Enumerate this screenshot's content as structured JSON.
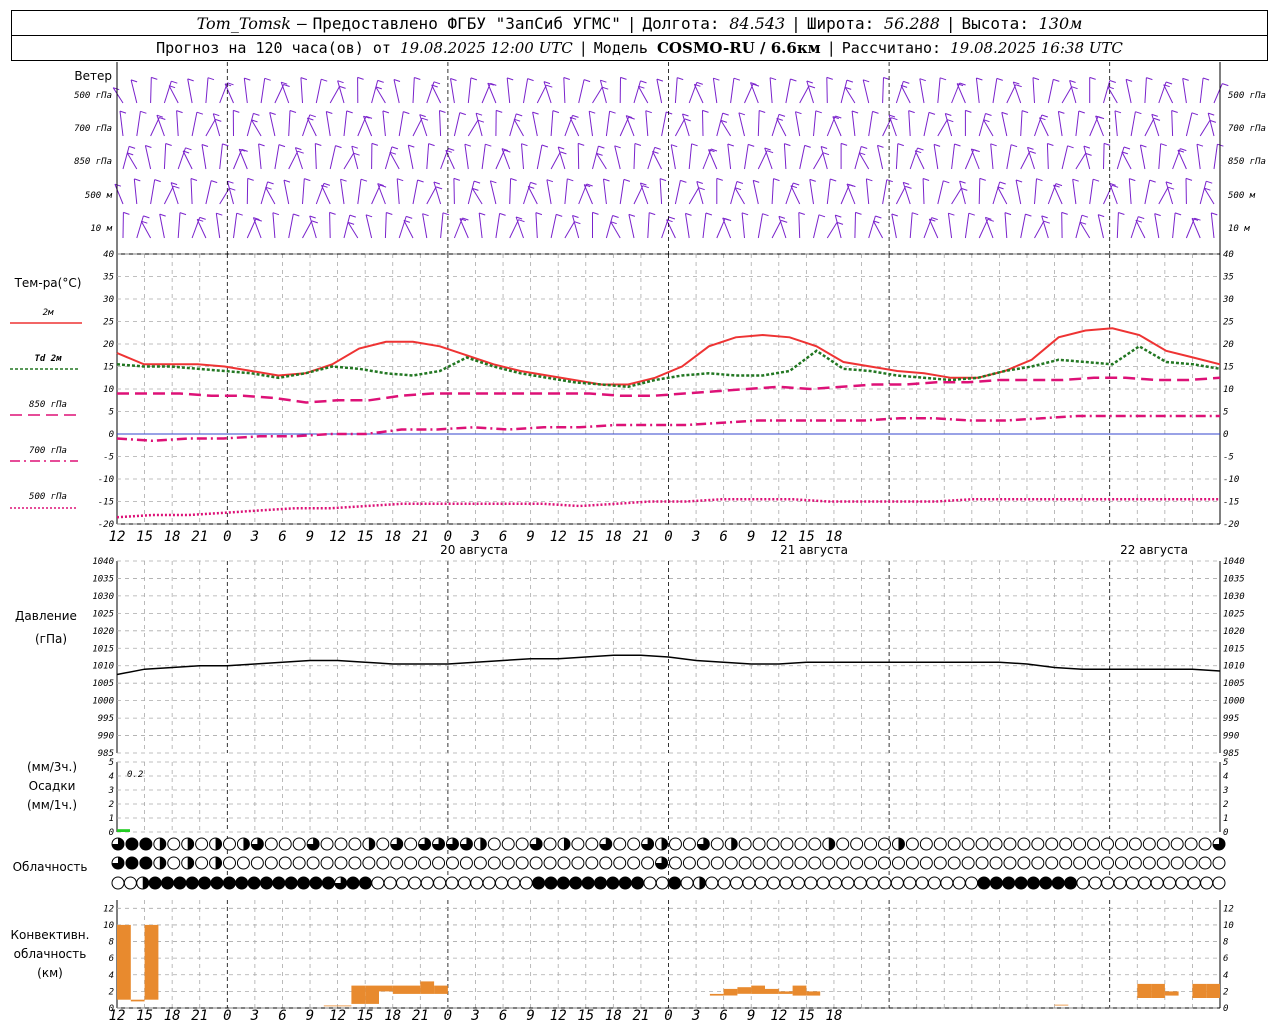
{
  "header": {
    "station": "Tom_Tomsk",
    "dash": "–",
    "provider": "Предоставлено ФГБУ \"ЗапСиб УГМС\"",
    "lon_label": "Долгота:",
    "lon": "84.543",
    "lat_label": "Широта:",
    "lat": "56.288",
    "alt_label": "Высота:",
    "alt": "130м",
    "forecast_prefix": "Прогноз на 120 часа(ов) от",
    "forecast_date": "19.08.2025 12:00 UTC",
    "model_label": "Модель",
    "model": "COSMO-RU / 6.6км",
    "computed_label": "Рассчитано:",
    "computed": "19.08.2025 16:38 UTC"
  },
  "wind_panel": {
    "title": "Ветер",
    "levels": [
      "500 гПа",
      "700 гПа",
      "850 гПа",
      "500 м",
      "10  м"
    ],
    "right_levels": [
      "500 гПа",
      "700 гПа",
      "850 гПа",
      "500 м",
      "10  м"
    ]
  },
  "temp_panel": {
    "title": "Тем-ра(°C)",
    "legend": [
      {
        "label": "2м",
        "color": "#ee3333",
        "dash": ""
      },
      {
        "label": "Td  2м",
        "color": "#227722",
        "dash": "3,2"
      },
      {
        "label": "850 гПа",
        "color": "#dd1177",
        "dash": "12,6"
      },
      {
        "label": "700 гПа",
        "color": "#dd1177",
        "dash": "10,4,2,4"
      },
      {
        "label": "500 гПа",
        "color": "#dd1177",
        "dash": "2,2"
      }
    ]
  },
  "pressure_panel": {
    "title": "Давление",
    "unit": "(гПа)"
  },
  "precip_panel": {
    "unit_top": "(мм/3ч.)",
    "title": "Осадки",
    "unit_bottom": "(мм/1ч.)",
    "annotation": "0.2"
  },
  "cloud_panel": {
    "title": "Облачность"
  },
  "conv_panel": {
    "title_1": "Конвективн.",
    "title_2": "облачность",
    "unit": "(км)"
  },
  "x_hour_labels": [
    "12",
    "15",
    "18",
    "21",
    "0",
    "3",
    "6",
    "9",
    "12",
    "15",
    "18",
    "21",
    "0",
    "3",
    "6",
    "9",
    "12",
    "15",
    "18",
    "21",
    "0",
    "3",
    "6",
    "9",
    "12",
    "15",
    "18"
  ],
  "date_labels": [
    "20 августа",
    "21 августа",
    "22 августа"
  ],
  "chart_data": [
    {
      "type": "line",
      "name": "temperature",
      "ylim": [
        -20,
        40
      ],
      "yticks": [
        -20,
        -15,
        -10,
        -5,
        0,
        5,
        10,
        15,
        20,
        25,
        30,
        35,
        40
      ],
      "x_hours": [
        0,
        3,
        6,
        9,
        12,
        15,
        18,
        21,
        24,
        27,
        30,
        33,
        36,
        39,
        42,
        45,
        48,
        51,
        54,
        57,
        60,
        63,
        66,
        69,
        72,
        75,
        78,
        81,
        84,
        87,
        90,
        93,
        96,
        99,
        102,
        105,
        108,
        111,
        114,
        117,
        120
      ],
      "series": [
        {
          "name": "2м",
          "values": [
            18,
            15.5,
            15.5,
            15.5,
            15,
            14,
            13,
            13.5,
            15.5,
            19,
            20.5,
            20.5,
            19.5,
            17.5,
            15.5,
            14,
            13,
            12,
            11,
            11,
            12.5,
            15,
            19.5,
            21.5,
            22,
            21.5,
            19.5,
            16,
            15,
            14,
            13.5,
            12.5,
            12.5,
            14,
            16.5,
            21.5,
            23,
            23.5,
            22,
            18.5,
            17,
            15.5
          ]
        },
        {
          "name": "Td  2м",
          "values": [
            15.5,
            15,
            15,
            14.5,
            14,
            13.5,
            12.5,
            13.5,
            15,
            14.5,
            13.5,
            13,
            14,
            17,
            15,
            13.5,
            12.5,
            11.5,
            11,
            10.5,
            12,
            13,
            13.5,
            13,
            13,
            14,
            18.5,
            14.5,
            14,
            13,
            12.5,
            12,
            12.5,
            14,
            15,
            16.5,
            16,
            15.5,
            19.5,
            16,
            15.5,
            14.5
          ]
        },
        {
          "name": "850 гПа",
          "values": [
            9,
            9,
            9,
            8.5,
            8.5,
            8,
            7,
            7.5,
            7.5,
            8.5,
            9,
            9,
            9,
            9,
            9,
            9,
            8.5,
            8.5,
            9,
            9.5,
            10,
            10.5,
            10,
            10.5,
            11,
            11,
            11.5,
            11.5,
            12,
            12,
            12,
            12.5,
            12.5,
            12,
            12,
            12.5
          ]
        },
        {
          "name": "700 гПа",
          "values": [
            -1,
            -1.5,
            -1,
            -1,
            -0.5,
            -0.5,
            0,
            0,
            1,
            1,
            1.5,
            1,
            1.5,
            1.5,
            2,
            2,
            2,
            2.5,
            3,
            3,
            3,
            3,
            3.5,
            3.5,
            3,
            3,
            3.5,
            4,
            4,
            4,
            4,
            4
          ]
        },
        {
          "name": "500 гПа",
          "values": [
            -18.5,
            -18,
            -18,
            -17.5,
            -17,
            -16.5,
            -16.5,
            -16,
            -15.5,
            -15.5,
            -15.5,
            -15.5,
            -15.5,
            -16,
            -15.5,
            -15,
            -15,
            -14.5,
            -14.5,
            -14.5,
            -15,
            -15,
            -15,
            -15,
            -14.5,
            -14.5,
            -14.5,
            -14.5,
            -14.5,
            -14.5,
            -14.5,
            -14.5
          ]
        }
      ]
    },
    {
      "type": "line",
      "name": "pressure",
      "ylim": [
        985,
        1040
      ],
      "yticks": [
        985,
        990,
        995,
        1000,
        1005,
        1010,
        1015,
        1020,
        1025,
        1030,
        1035,
        1040
      ],
      "x_hours": [
        0,
        3,
        6,
        9,
        12,
        15,
        18,
        21,
        24,
        27,
        30,
        33,
        36,
        39,
        42,
        45,
        48,
        51,
        54,
        57,
        60,
        63,
        66,
        69,
        72,
        75,
        78,
        81,
        84,
        87,
        90,
        93,
        96,
        99,
        102,
        105,
        108,
        111,
        114,
        117,
        120
      ],
      "values": [
        1007.5,
        1009,
        1009.5,
        1010,
        1010,
        1010.5,
        1011,
        1011.5,
        1011.5,
        1011,
        1010.5,
        1010.5,
        1010.5,
        1011,
        1011.5,
        1012,
        1012,
        1012.5,
        1013,
        1013,
        1012.5,
        1011.5,
        1011,
        1010.5,
        1010.5,
        1011,
        1011,
        1011,
        1011,
        1011,
        1011,
        1011,
        1011,
        1010.5,
        1009.5,
        1009,
        1009,
        1009,
        1009,
        1009,
        1008.5
      ]
    },
    {
      "type": "bar",
      "name": "precipitation",
      "ylim": [
        0,
        5
      ],
      "yticks": [
        0,
        1,
        2,
        3,
        4,
        5
      ],
      "x_hours": [
        0
      ],
      "values": [
        0.2
      ],
      "color": "#22cc22"
    },
    {
      "type": "bar",
      "name": "convective_cloud",
      "ylim": [
        0,
        13
      ],
      "yticks": [
        0,
        2,
        4,
        6,
        8,
        10,
        12
      ],
      "color": "#e88a2e",
      "bars": [
        {
          "h": 0,
          "base": 1.0,
          "top": 10.0
        },
        {
          "h": 1,
          "base": 0.8,
          "top": 1.0
        },
        {
          "h": 2,
          "base": 1.0,
          "top": 10.0
        },
        {
          "h": 15,
          "base": 0.2,
          "top": 0.3
        },
        {
          "h": 16,
          "base": 0.2,
          "top": 0.3
        },
        {
          "h": 17,
          "base": 0.5,
          "top": 2.7
        },
        {
          "h": 18,
          "base": 0.5,
          "top": 2.7
        },
        {
          "h": 19,
          "base": 2.0,
          "top": 2.7
        },
        {
          "h": 20,
          "base": 1.7,
          "top": 2.7
        },
        {
          "h": 21,
          "base": 1.7,
          "top": 2.7
        },
        {
          "h": 22,
          "base": 1.7,
          "top": 3.2
        },
        {
          "h": 23,
          "base": 1.7,
          "top": 2.7
        },
        {
          "h": 43,
          "base": 1.5,
          "top": 1.7
        },
        {
          "h": 44,
          "base": 1.5,
          "top": 2.3
        },
        {
          "h": 45,
          "base": 1.7,
          "top": 2.5
        },
        {
          "h": 46,
          "base": 1.7,
          "top": 2.7
        },
        {
          "h": 47,
          "base": 1.7,
          "top": 2.3
        },
        {
          "h": 48,
          "base": 1.7,
          "top": 2.0
        },
        {
          "h": 49,
          "base": 1.5,
          "top": 2.7
        },
        {
          "h": 50,
          "base": 1.5,
          "top": 2.0
        },
        {
          "h": 68,
          "base": 0.3,
          "top": 0.4
        },
        {
          "h": 74,
          "base": 1.2,
          "top": 2.9
        },
        {
          "h": 75,
          "base": 1.2,
          "top": 2.9
        },
        {
          "h": 76,
          "base": 1.5,
          "top": 2.0
        },
        {
          "h": 78,
          "base": 1.2,
          "top": 2.9
        },
        {
          "h": 79,
          "base": 1.2,
          "top": 2.9
        }
      ]
    },
    {
      "type": "table",
      "name": "cloud_cover_octas",
      "rows": [
        [
          7,
          8,
          8,
          4,
          0,
          4,
          0,
          4,
          0,
          4,
          7,
          0,
          0,
          0,
          7,
          0,
          0,
          0,
          4,
          0,
          7,
          0,
          6,
          7,
          7,
          7,
          4,
          0,
          0,
          0,
          7,
          0,
          4,
          0,
          0,
          6,
          0,
          0,
          7,
          4,
          0,
          0,
          7,
          0,
          4,
          0,
          0,
          0,
          0,
          0,
          0,
          4,
          0,
          0,
          0,
          0,
          4,
          0,
          0,
          0,
          0,
          0,
          0,
          0,
          0,
          0,
          0,
          0,
          0,
          0,
          0,
          0,
          0,
          0,
          0,
          0,
          0,
          0,
          0,
          7
        ],
        [
          7,
          8,
          8,
          4,
          0,
          4,
          0,
          4,
          0,
          0,
          0,
          0,
          0,
          0,
          0,
          0,
          0,
          0,
          0,
          0,
          0,
          0,
          0,
          0,
          0,
          0,
          0,
          0,
          0,
          0,
          0,
          0,
          0,
          0,
          0,
          0,
          0,
          0,
          0,
          7,
          0,
          0,
          0,
          0,
          0,
          0,
          0,
          0,
          0,
          0,
          0,
          0,
          0,
          0,
          0,
          0,
          0,
          0,
          0,
          0,
          0,
          0,
          0,
          0,
          0,
          0,
          0,
          0,
          0,
          0,
          0,
          0,
          0,
          0,
          0,
          0,
          0,
          0,
          0,
          0
        ],
        [
          0,
          0,
          4,
          8,
          8,
          8,
          8,
          8,
          8,
          8,
          8,
          8,
          8,
          8,
          8,
          8,
          8,
          8,
          7,
          8,
          8,
          0,
          0,
          0,
          0,
          0,
          0,
          0,
          0,
          0,
          0,
          0,
          0,
          0,
          8,
          8,
          8,
          8,
          8,
          8,
          8,
          8,
          8,
          0,
          0,
          8,
          0,
          4,
          0,
          0,
          0,
          0,
          0,
          0,
          0,
          0,
          0,
          0,
          0,
          0,
          0,
          0,
          0,
          0,
          0,
          0,
          0,
          0,
          0,
          0,
          8,
          8,
          8,
          8,
          8,
          8,
          8,
          8,
          0,
          0,
          0,
          0,
          0,
          0,
          0,
          0,
          0,
          0,
          0,
          0
        ]
      ]
    }
  ]
}
